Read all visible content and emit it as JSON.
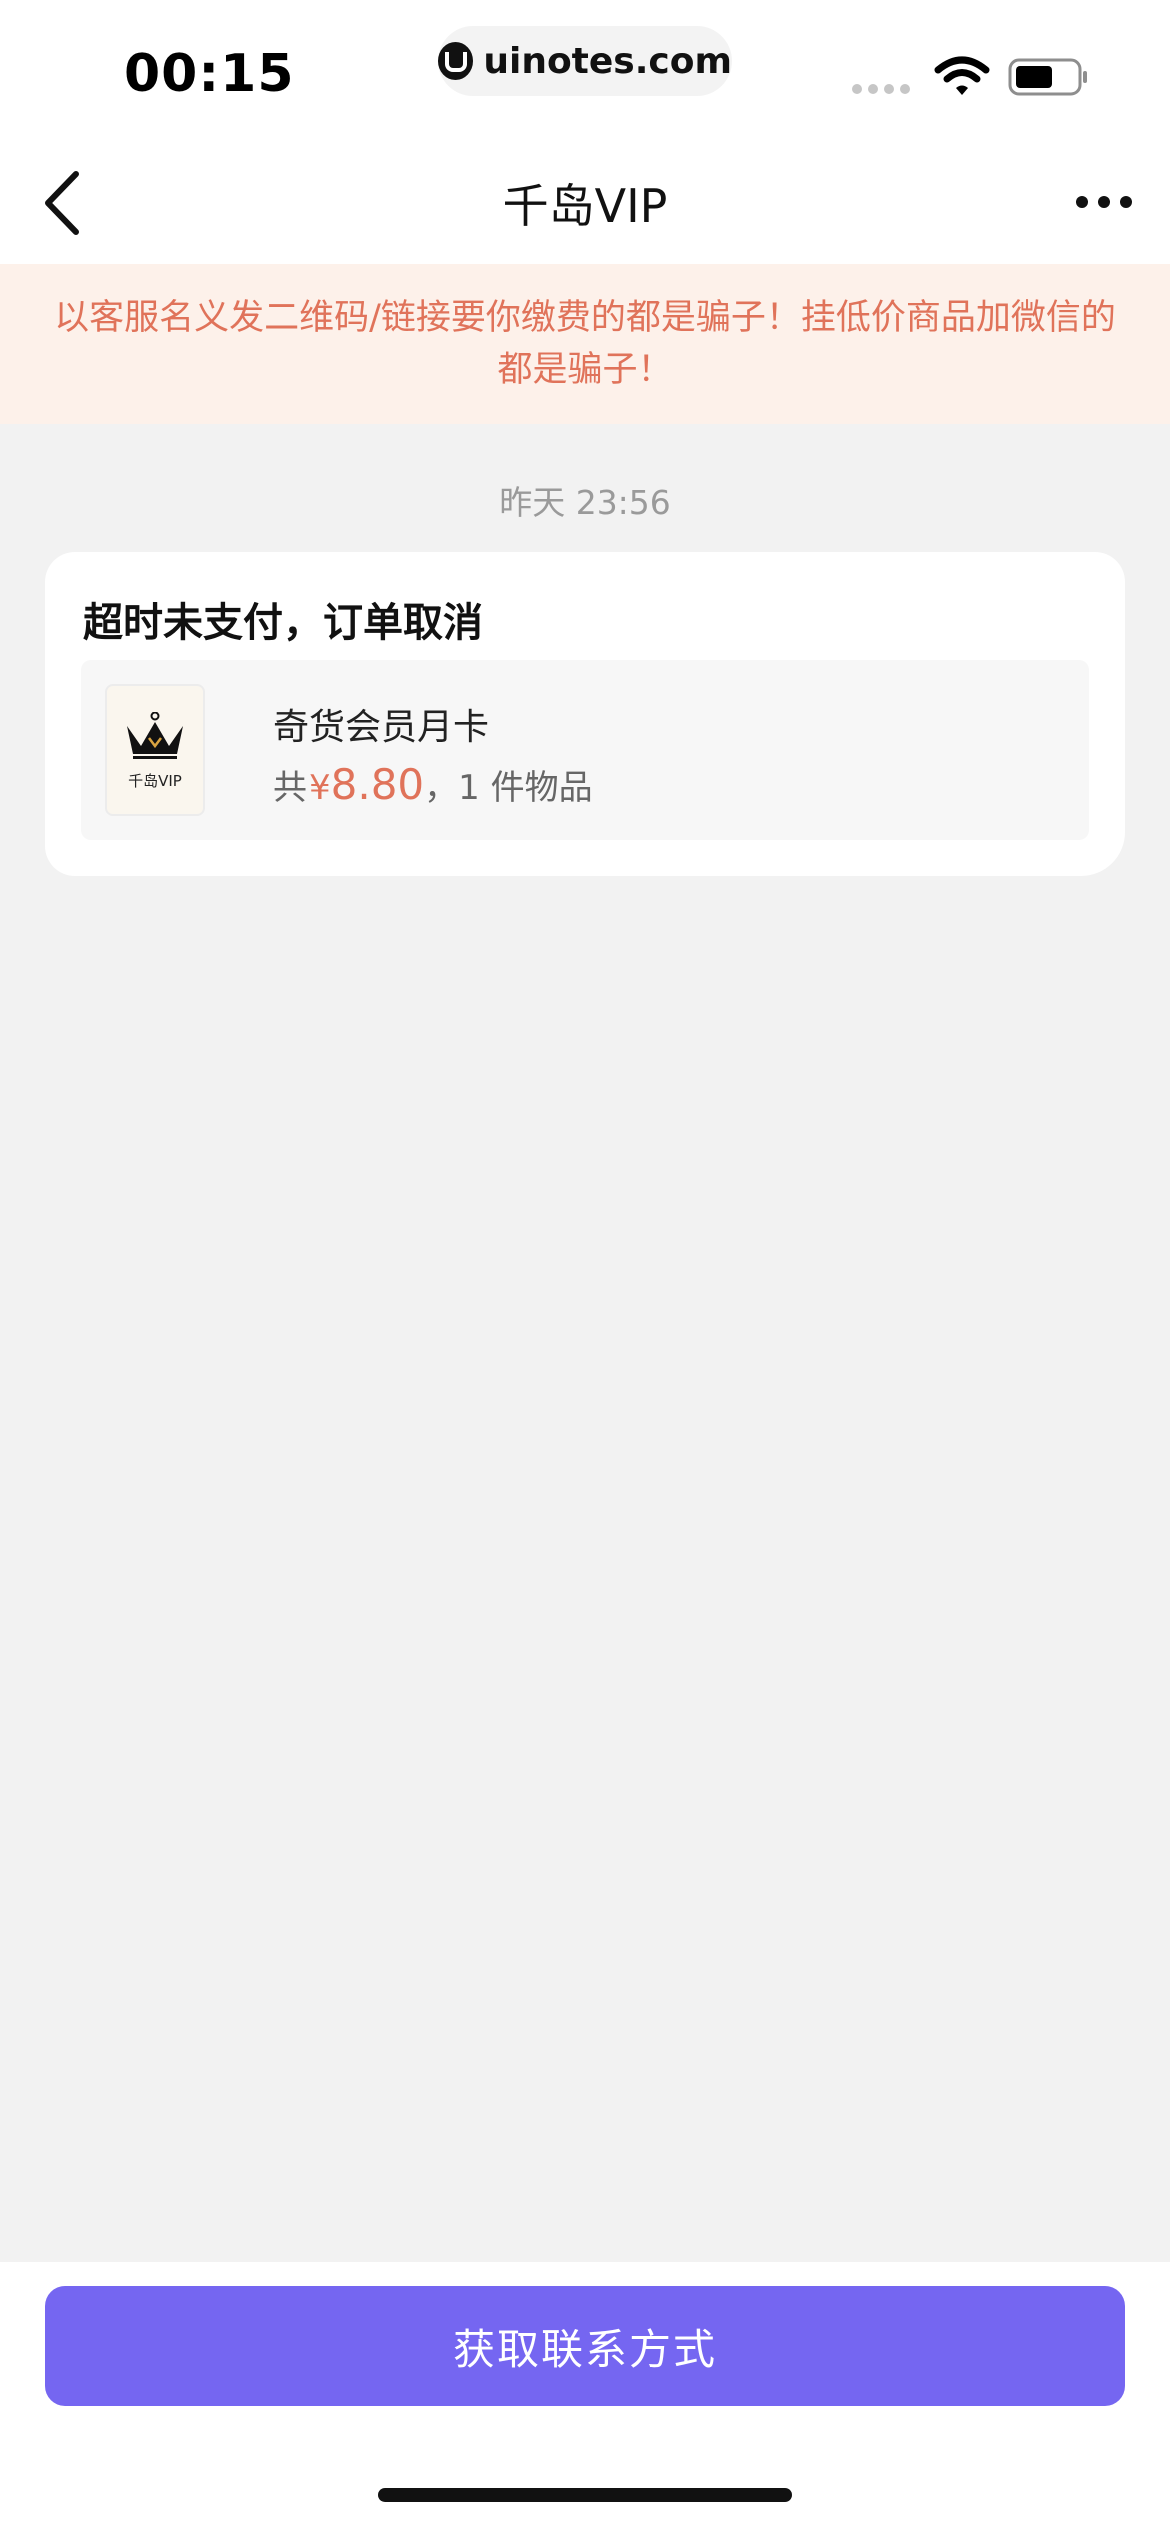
{
  "status_bar": {
    "time": "00:15",
    "url": "uinotes.com"
  },
  "nav": {
    "title": "千岛VIP",
    "icons": [
      "back-icon",
      "more-icon"
    ]
  },
  "warning": {
    "text": "以客服名义发二维码/链接要你缴费的都是骗子！挂低价商品加微信的都是骗子！"
  },
  "chat": {
    "timestamp": "昨天 23:56",
    "card": {
      "title": "超时未支付，订单取消",
      "product": {
        "thumb_label": "千岛VIP",
        "name": "奇货会员月卡",
        "total_prefix": "共",
        "currency": "¥",
        "price": "8.80",
        "count_text": "，1 件物品"
      }
    }
  },
  "footer": {
    "button_label": "获取联系方式"
  },
  "colors": {
    "accent": "#7566f1",
    "warning_text": "#e0735a",
    "warning_bg": "#fdf1ea",
    "page_bg": "#f2f2f2"
  }
}
